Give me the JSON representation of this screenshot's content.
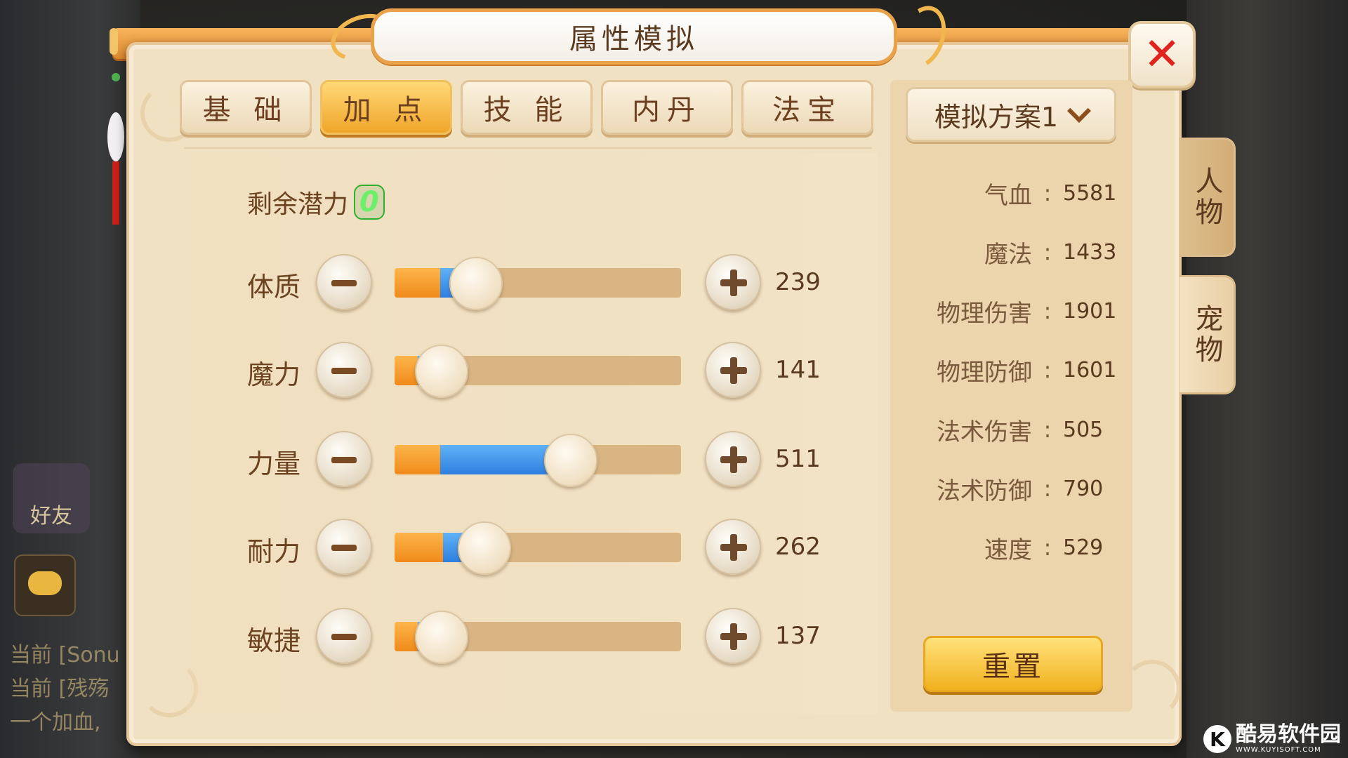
{
  "title": "属性模拟",
  "close_label": "✕",
  "tabs": [
    {
      "label": "基 础",
      "active": false
    },
    {
      "label": "加 点",
      "active": true
    },
    {
      "label": "技 能",
      "active": false
    },
    {
      "label": "内丹",
      "active": false
    },
    {
      "label": "法宝",
      "active": false
    }
  ],
  "remaining": {
    "label": "剩余潜力",
    "value": "0"
  },
  "attributes": [
    {
      "label": "体质",
      "value": "239",
      "base_fraction": 0.16,
      "fill_fraction": 0.28
    },
    {
      "label": "魔力",
      "value": "141",
      "base_fraction": 0.08,
      "fill_fraction": 0.16
    },
    {
      "label": "力量",
      "value": "511",
      "base_fraction": 0.16,
      "fill_fraction": 0.61
    },
    {
      "label": "耐力",
      "value": "262",
      "base_fraction": 0.17,
      "fill_fraction": 0.31
    },
    {
      "label": "敏捷",
      "value": "137",
      "base_fraction": 0.08,
      "fill_fraction": 0.16
    }
  ],
  "scheme": {
    "label": "模拟方案1"
  },
  "stats": [
    {
      "label": "气血",
      "value": "5581"
    },
    {
      "label": "魔法",
      "value": "1433"
    },
    {
      "label": "物理伤害",
      "value": "1901"
    },
    {
      "label": "物理防御",
      "value": "1601"
    },
    {
      "label": "法术伤害",
      "value": "505"
    },
    {
      "label": "法术防御",
      "value": "790"
    },
    {
      "label": "速度",
      "value": "529"
    }
  ],
  "reset_label": "重置",
  "side_tabs": {
    "people": "人物",
    "pet": "宠物"
  },
  "background": {
    "friends_label": "好友",
    "chat_lines": [
      "当前 [Sonu",
      "当前 [残殇",
      "一个加血,"
    ]
  },
  "watermark": {
    "logo": "K",
    "main": "酷易软件园",
    "sub": "WWW.KUYISOFT.COM"
  },
  "colors": {
    "accent_orange": "#f08a1b",
    "accent_blue": "#2d7fe0",
    "close_red": "#e0231d",
    "potential_green": "#3de33c"
  }
}
